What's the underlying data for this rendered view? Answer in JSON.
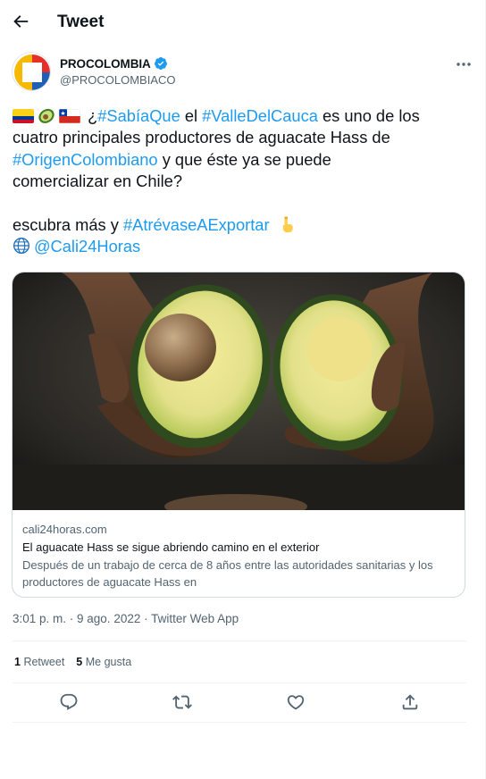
{
  "header": {
    "title": "Tweet",
    "back_icon": "arrow-left-icon"
  },
  "author": {
    "name": "PROCOLOMBIA",
    "handle": "@PROCOLOMBIACO",
    "verified": true,
    "verified_color": "#1d9bf0"
  },
  "tweet": {
    "line1_punct": " ¿",
    "line1_tag1": "#SabíaQue",
    "line1_mid": " el ",
    "line1_tag2": "#ValleDelCauca",
    "line1_end": " es uno de los",
    "line2": "cuatro principales productores de aguacate Hass de",
    "line3_tag": "#OrigenColombiano",
    "line3_end": " y que éste ya se puede",
    "line4": "comercializar en Chile?",
    "line5_start": "escubra más y ",
    "line5_tag": "#AtrévaseAExportar",
    "line6_mention": "@Cali24Horas",
    "emojis": [
      "colombia-flag",
      "avocado",
      "chile-flag",
      "pointing-down-hand",
      "globe"
    ]
  },
  "card": {
    "image_alt": "Hands holding avocado halves",
    "domain": "cali24horas.com",
    "title": "El aguacate Hass se sigue abriendo camino en el exterior",
    "description_line1": "Después de un trabajo de cerca de 8 años entre las autoridades sanitarias y los",
    "description_line2": "productores de aguacate Hass en"
  },
  "meta": {
    "text": "3:01 p. m. · 9 ago. 2022 · Twitter Web App"
  },
  "stats": {
    "retweets_count": "1",
    "retweets_label": "Retweet",
    "likes_count": "5",
    "likes_label": "Me gusta"
  },
  "actions": [
    "reply-icon",
    "retweet-icon",
    "like-icon",
    "share-icon"
  ],
  "colors": {
    "link": "#1d9bf0",
    "text": "#0f1419",
    "secondary": "#536471",
    "border": "#cfd9de"
  }
}
